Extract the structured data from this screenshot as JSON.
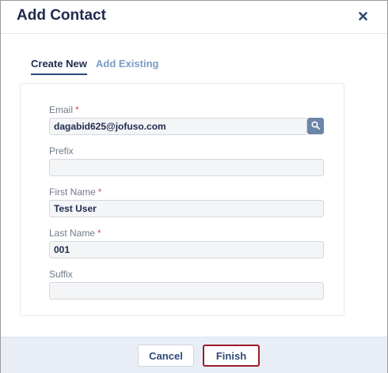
{
  "dialog": {
    "title": "Add Contact",
    "close_icon": "close-icon"
  },
  "tabs": [
    {
      "label": "Create New",
      "active": true
    },
    {
      "label": "Add Existing",
      "active": false
    }
  ],
  "form": {
    "email": {
      "label": "Email",
      "required": true,
      "required_marker": "*",
      "value": "dagabid625@jofuso.com",
      "search_icon": "search-icon"
    },
    "prefix": {
      "label": "Prefix",
      "required": false,
      "value": ""
    },
    "first_name": {
      "label": "First Name",
      "required": true,
      "required_marker": "*",
      "value": "Test User"
    },
    "last_name": {
      "label": "Last Name",
      "required": true,
      "required_marker": "*",
      "value": "001"
    },
    "suffix": {
      "label": "Suffix",
      "required": false,
      "value": ""
    }
  },
  "footer": {
    "cancel_label": "Cancel",
    "finish_label": "Finish"
  },
  "colors": {
    "title": "#1f2b4d",
    "accent": "#2e4a7a",
    "inactive_tab": "#7a9cc4",
    "required": "#d9534f",
    "footer_bg": "#e9eef6",
    "finish_border": "#9c1b2a"
  }
}
